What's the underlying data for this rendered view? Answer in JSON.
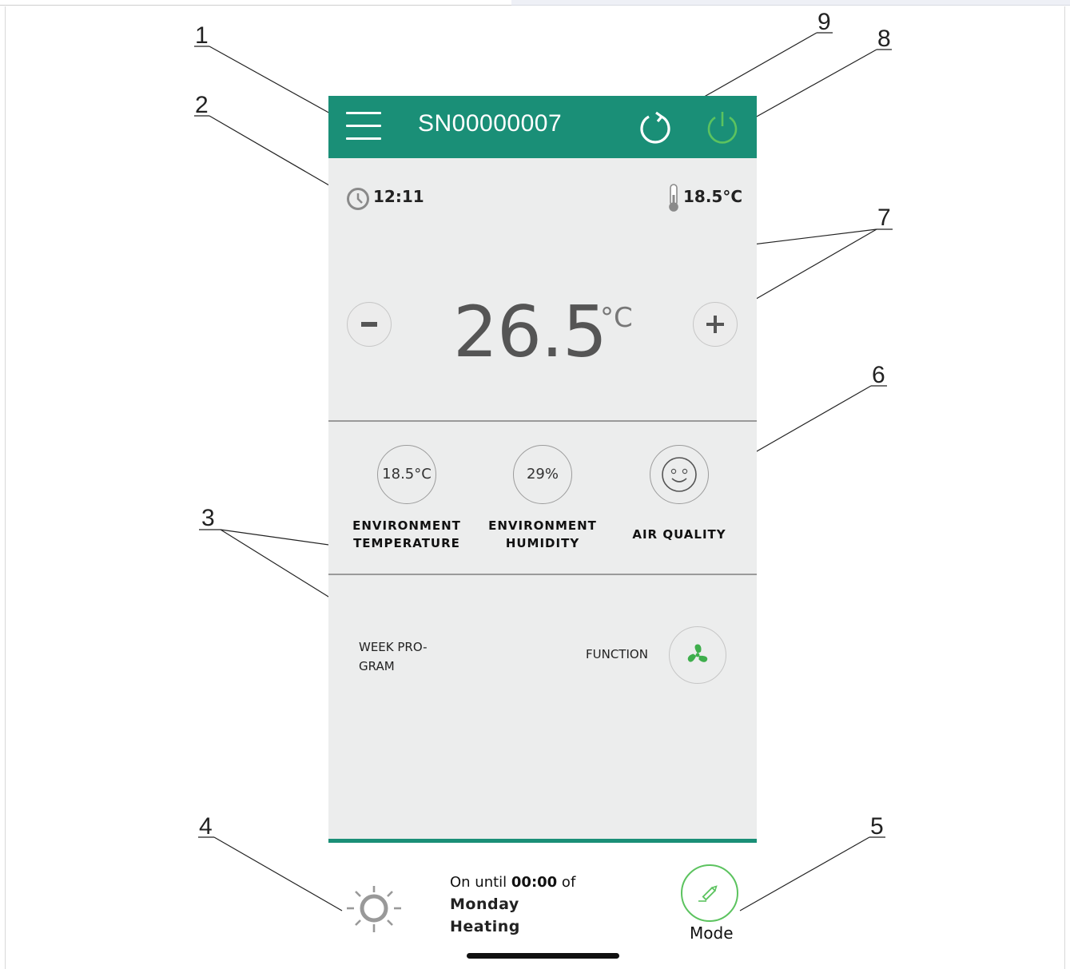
{
  "header": {
    "device_title": "SN00000007"
  },
  "info_row": {
    "time": "12:11",
    "room_temperature": "18.5°C"
  },
  "setpoint": {
    "value": "26.5",
    "unit": "°C"
  },
  "metrics": [
    {
      "value": "18.5°C",
      "label_line1": "ENVIRONMENT",
      "label_line2": "TEMPERATURE"
    },
    {
      "value": "29%",
      "label_line1": "ENVIRONMENT",
      "label_line2": "HUMIDITY"
    },
    {
      "icon": "smiley-face-icon",
      "label_line1": "AIR QUALITY"
    }
  ],
  "week_program": {
    "label_line1": "WEEK PRO-",
    "label_line2": "GRAM"
  },
  "function": {
    "label": "FUNCTION",
    "icon": "fan-icon"
  },
  "status": {
    "prefix": "On until ",
    "time": "00:00",
    "suffix": " of",
    "day": "Monday",
    "mode": "Heating"
  },
  "mode_button": {
    "label": "Mode",
    "icon": "pencil-icon"
  },
  "callouts": [
    "1",
    "2",
    "3",
    "4",
    "5",
    "6",
    "7",
    "8",
    "9"
  ],
  "colors": {
    "header_green": "#1a8f77",
    "power_green": "#5cc35f",
    "panel_gray": "#eceded"
  }
}
